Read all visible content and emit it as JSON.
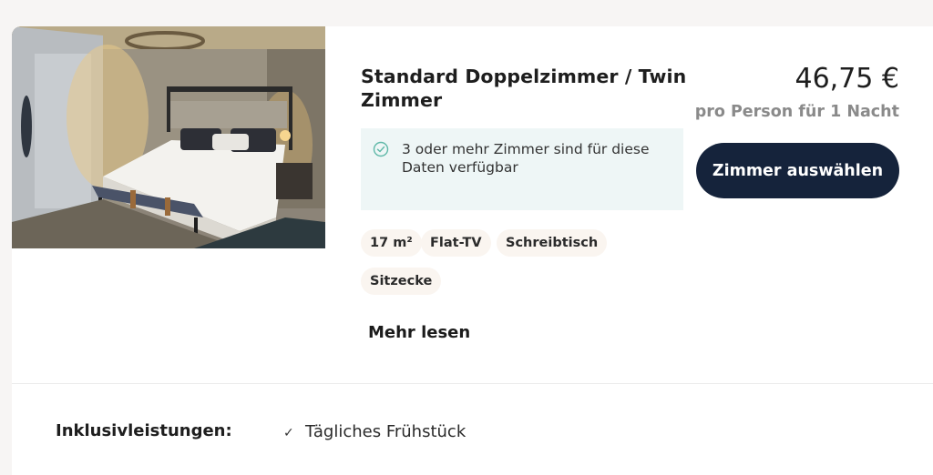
{
  "room": {
    "title": "Standard Doppelzimmer / Twin Zimmer",
    "image_alt": "room-photo",
    "availability": "3 oder mehr Zimmer sind für diese Daten verfügbar",
    "features": [
      "17 m²",
      "Flat-TV",
      "Schreibtisch",
      "Sitzecke"
    ],
    "more_label": "Mehr lesen"
  },
  "pricing": {
    "price": "46,75 €",
    "note": "pro Person für 1 Nacht",
    "select_label": "Zimmer auswählen"
  },
  "inclusions": {
    "label": "Inklusivleistungen:",
    "items": [
      "Tägliches Frühstück"
    ]
  },
  "colors": {
    "button_bg": "#15233b",
    "availability_bg": "#eef6f6",
    "check_icon": "#5fb8a8",
    "tag_bg": "#faf5f0"
  },
  "icons": {
    "availability": "check-circle-icon",
    "inclusion": "checkmark-icon"
  }
}
